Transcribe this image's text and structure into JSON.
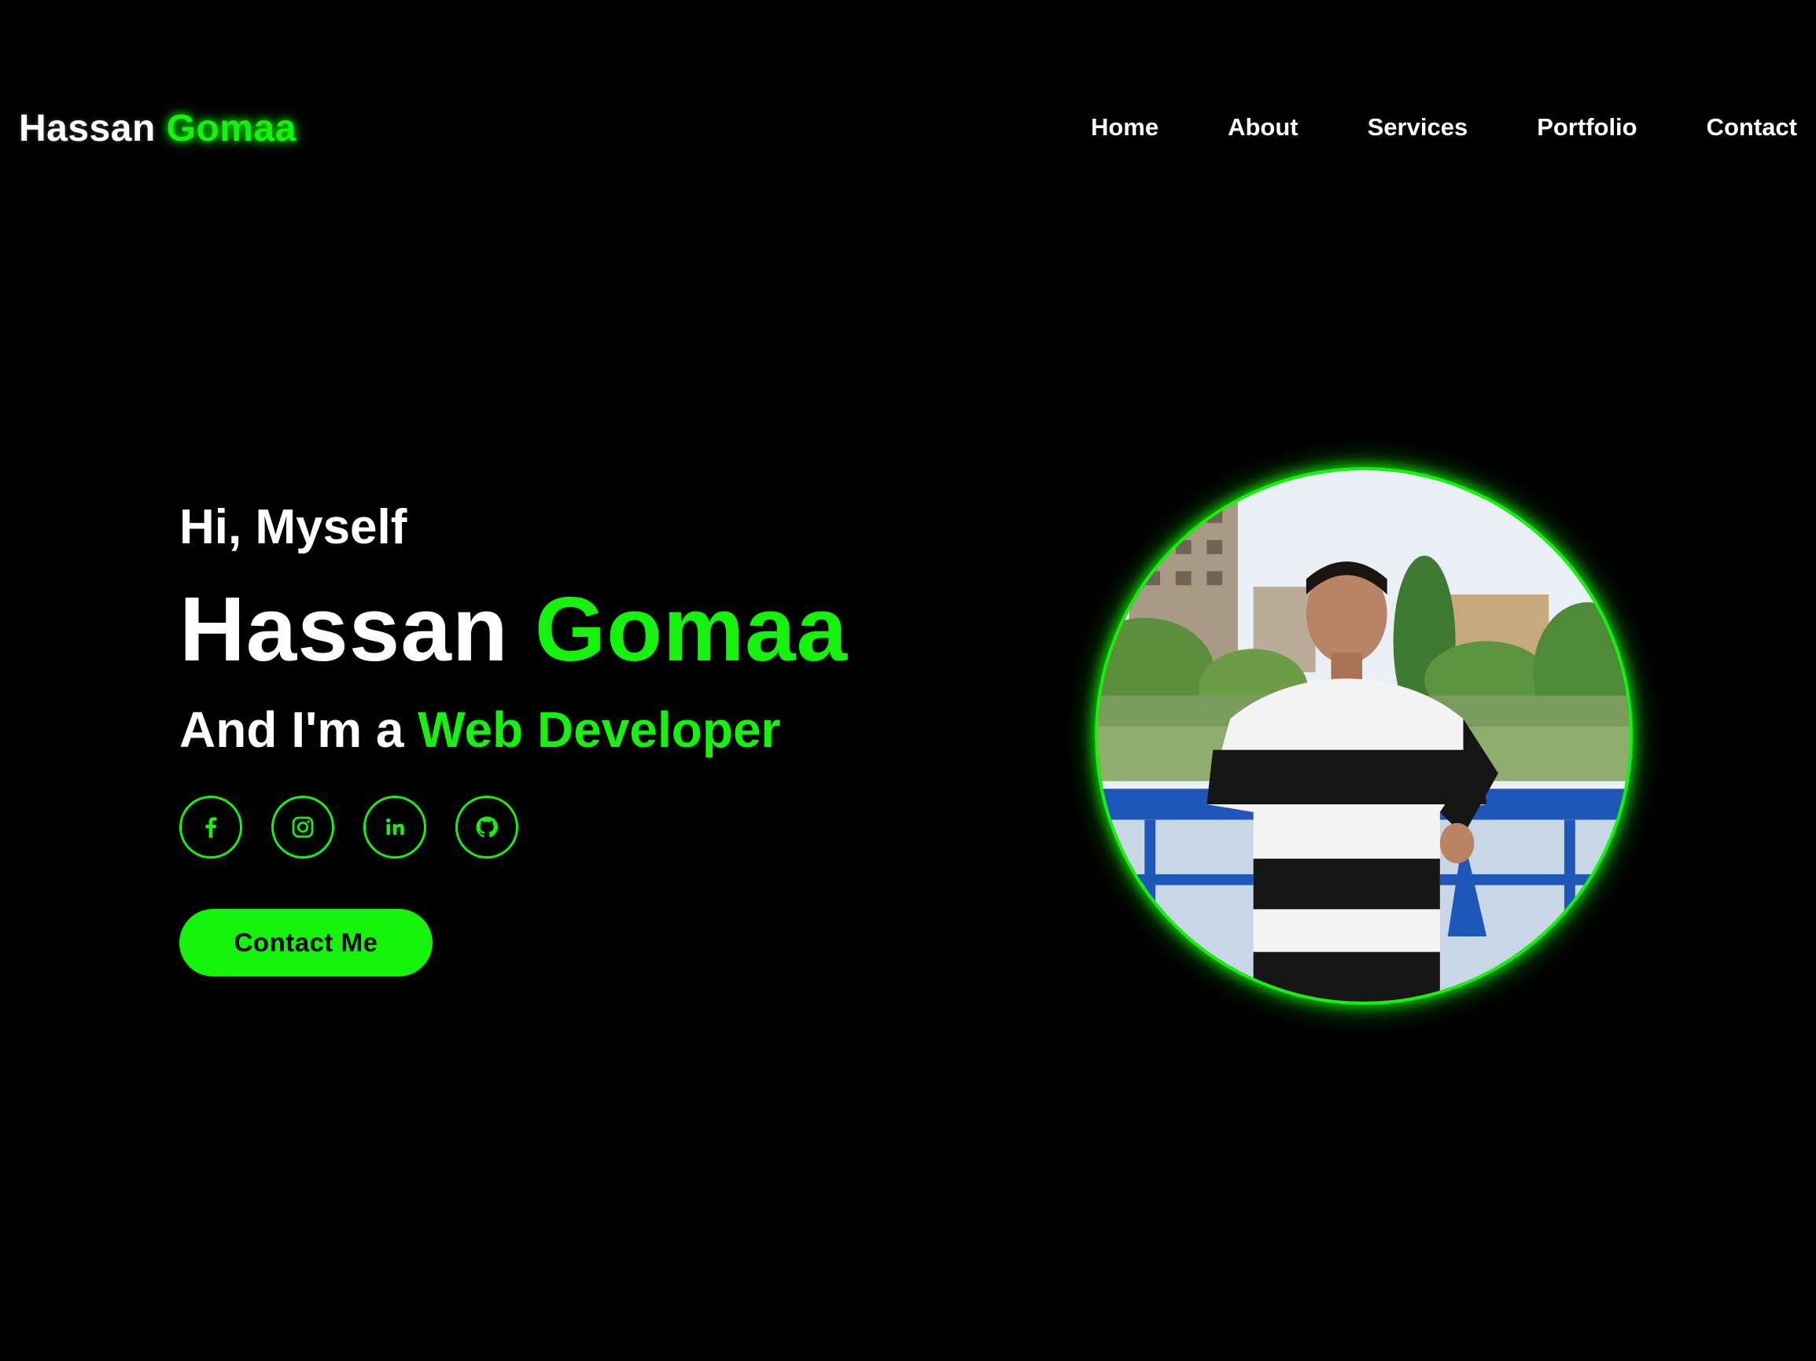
{
  "brand": {
    "first": "Hassan",
    "last": "Gomaa"
  },
  "nav": {
    "items": [
      {
        "label": "Home"
      },
      {
        "label": "About"
      },
      {
        "label": "Services"
      },
      {
        "label": "Portfolio"
      },
      {
        "label": "Contact"
      }
    ]
  },
  "hero": {
    "greeting": "Hi, Myself",
    "name_first": "Hassan",
    "name_last": "Gomaa",
    "role_lead": "And I'm a",
    "role_accent": "Web Developer",
    "cta_label": "Contact Me"
  },
  "socials": [
    {
      "icon": "facebook-icon"
    },
    {
      "icon": "instagram-icon"
    },
    {
      "icon": "linkedin-icon"
    },
    {
      "icon": "github-icon"
    }
  ],
  "theme": {
    "background": "#000000",
    "accent": "#15f20c",
    "text": "#ffffff"
  }
}
